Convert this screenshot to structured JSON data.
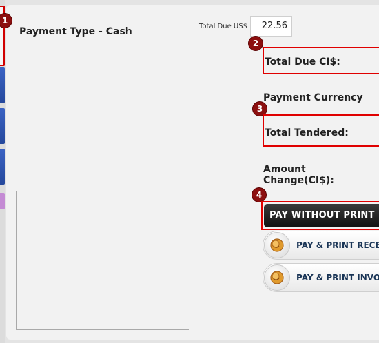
{
  "markers": [
    "1",
    "2",
    "3",
    "4"
  ],
  "payment": {
    "type_label": "Payment Type - Cash",
    "total_due_us_label": "Total Due US$",
    "total_due_us_value": "22.56",
    "total_due_ci_label": "Total Due CI$:",
    "payment_currency_label": "Payment Currency",
    "total_tendered_label": "Total Tendered:",
    "amount_change_label": "Amount Change(CI$):"
  },
  "buttons": {
    "pay_without_print": "PAY WITHOUT PRINT",
    "pay_print_receipt": "PAY & PRINT RECE",
    "pay_print_invoice": "PAY & PRINT INVO"
  },
  "icons": {
    "coin": "coin-icon"
  },
  "colors": {
    "highlight_red": "#e00000",
    "marker": "#8c0f0f",
    "dark_button": "#111111",
    "pill_text": "#1a3556"
  }
}
